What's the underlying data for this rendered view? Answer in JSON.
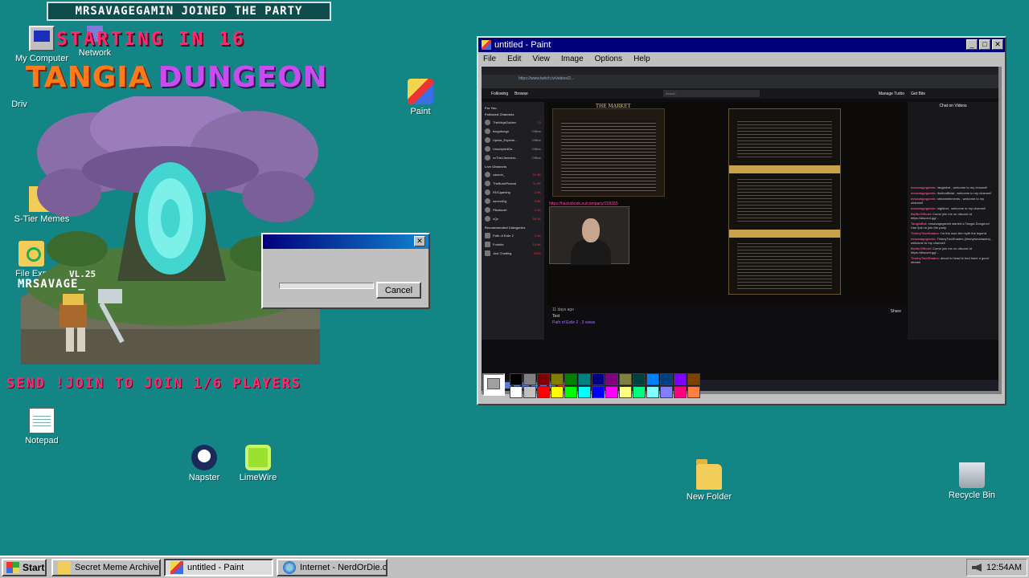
{
  "desktop": {
    "icons": {
      "my_computer": "My Computer",
      "network": "Network",
      "drive": "Driv",
      "s_tier_memes": "S-Tier Memes",
      "file_explorer": "File Exp",
      "paint": "Paint",
      "notepad": "Notepad",
      "napster": "Napster",
      "limewire": "LimeWire",
      "new_folder": "New Folder",
      "recycle_bin": "Recycle Bin"
    }
  },
  "overlay": {
    "join_banner": "MRSAVAGEGAMIN JOINED THE PARTY",
    "countdown": "STARTING IN 16",
    "logo_word1": "TANGIA",
    "logo_word2": "DUNGEON",
    "level": "VL.25",
    "player_name": "MRSAVAGE_",
    "join_prompt": "SEND !JOIN TO JOIN 1/6 PLAYERS",
    "colors": {
      "pink": "#ff2a6d",
      "orange": "#ff7a1a",
      "purple": "#c94cf0"
    }
  },
  "dialog": {
    "cancel_label": "Cancel",
    "close_glyph": "✕"
  },
  "paint_window": {
    "title": "untitled - Paint",
    "controls": {
      "minimize": "_",
      "maximize": "□",
      "close": "✕"
    },
    "menu": [
      "File",
      "Edit",
      "View",
      "Image",
      "Options",
      "Help"
    ],
    "palette_colors": [
      "#000000",
      "#808080",
      "#800000",
      "#808000",
      "#008000",
      "#008080",
      "#000080",
      "#800080",
      "#808040",
      "#004040",
      "#0080ff",
      "#004080",
      "#8000ff",
      "#804000",
      "#ffffff",
      "#c0c0c0",
      "#ff0000",
      "#ffff00",
      "#00ff00",
      "#00ffff",
      "#0000ff",
      "#ff00ff",
      "#ffff80",
      "#00ff80",
      "#80ffff",
      "#8080ff",
      "#ff0080",
      "#ff8040"
    ]
  },
  "inner_screenshot": {
    "url": "https://www.twitch.tv/videos/2...",
    "nav": {
      "following": "Following",
      "browse": "Browse",
      "search": "Search",
      "manage_turbo": "Manage Turbo",
      "get_bits": "Get Bits"
    },
    "sidebar": {
      "for_you": "For You",
      "followed_header": "Followed Channels",
      "followed": [
        {
          "name": "TheNinjaGolden",
          "status": "10"
        },
        {
          "name": "fuegofuego",
          "status": "Offline"
        },
        {
          "name": "Upriss_Experie...",
          "status": "Offline"
        },
        {
          "name": "UnscriptedDe...",
          "status": "Offline"
        },
        {
          "name": "xxTheCheezem...",
          "status": "Offline"
        }
      ],
      "live_header": "Live Channels",
      "live": [
        {
          "name": "caseoh_",
          "status": "51.3K"
        },
        {
          "name": "TheBurntPeanut",
          "status": "11.5K"
        },
        {
          "name": "RDCgaming",
          "status": "2.6K"
        },
        {
          "name": "summit1g",
          "status": "9.8K"
        },
        {
          "name": "Pikabooirl",
          "status": "4.1K"
        },
        {
          "name": "xQc",
          "status": "55.5K"
        }
      ],
      "recommended_header": "Recommended Categories",
      "recommended": [
        {
          "name": "Path of Exile 2",
          "status": "2.3K"
        },
        {
          "name": "Fortnite",
          "status": "19.8K"
        },
        {
          "name": "Just Chatting",
          "status": "321K"
        }
      ]
    },
    "market_title": "THE MARKET",
    "link_text": "https://hacksbook.eu/company/209265",
    "video_time": "11 days ago",
    "video_title": "Test",
    "video_meta": "Path of Exile 2 · 3 views",
    "share": "Share",
    "chat_title": "Chat on Videos",
    "chat": [
      {
        "user": "mrsavagegamin",
        "text": "!anglabot , welcome to my channel!"
      },
      {
        "user": "mrsavagegamin",
        "text": "!botfoofficial , welcome to my channel!"
      },
      {
        "user": "mrsavagegamin",
        "text": "streamelements , welcome to my channel!"
      },
      {
        "user": "mrsavagegamin",
        "text": "nightbot , welcome to my channel!"
      },
      {
        "user": "BotficOfficial",
        "text": "Come join me on discord at https://discord.gg/..."
      },
      {
        "user": "TangiaBot",
        "text": "mrsavagegamin started a Tangia Dungeon! Use !join to join the party."
      },
      {
        "user": "TimmyTwoShades",
        "text": "I'm the man the myth the legend"
      },
      {
        "user": "mrsavagegamin",
        "text": "TimmyTwoShades (timmytwoshades) , welcome to my channel!"
      },
      {
        "user": "BotficOfficial",
        "text": "Come join me on discord at https://discord.gg/..."
      },
      {
        "user": "TimmyTwoShades",
        "text": "about to head to bed have a good stream"
      }
    ]
  },
  "taskbar": {
    "start_label": "Start",
    "items": [
      {
        "label": "Secret Meme Archive",
        "active": false
      },
      {
        "label": "untitled - Paint",
        "active": true
      },
      {
        "label": "Internet - NerdOrDie.com",
        "active": false
      }
    ],
    "clock": "12:54AM"
  }
}
